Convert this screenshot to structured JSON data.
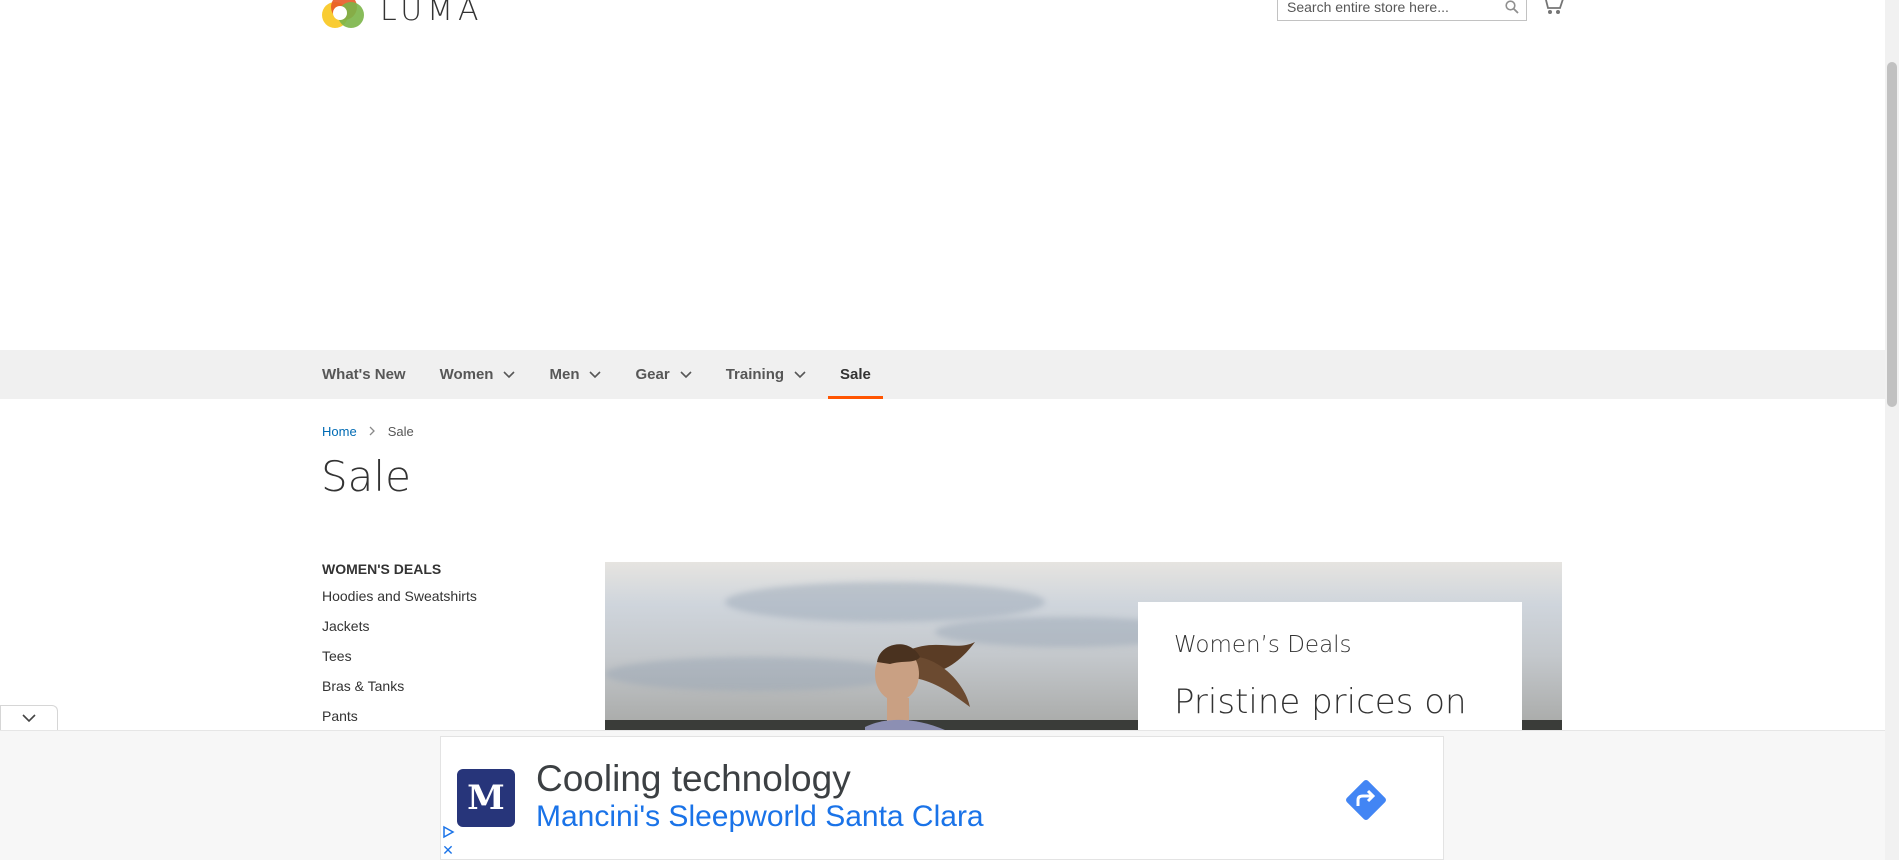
{
  "header": {
    "logo_text": "LUMA",
    "search_placeholder": "Search entire store here..."
  },
  "nav": {
    "items": [
      {
        "label": "What's New",
        "has_dropdown": false,
        "active": false
      },
      {
        "label": "Women",
        "has_dropdown": true,
        "active": false
      },
      {
        "label": "Men",
        "has_dropdown": true,
        "active": false
      },
      {
        "label": "Gear",
        "has_dropdown": true,
        "active": false
      },
      {
        "label": "Training",
        "has_dropdown": true,
        "active": false
      },
      {
        "label": "Sale",
        "has_dropdown": false,
        "active": true
      }
    ],
    "accent_color": "#ff5501"
  },
  "breadcrumb": {
    "home": "Home",
    "current": "Sale"
  },
  "page_title": "Sale",
  "sidebar": {
    "heading": "WOMEN'S DEALS",
    "links": [
      "Hoodies and Sweatshirts",
      "Jackets",
      "Tees",
      "Bras & Tanks",
      "Pants"
    ]
  },
  "banner": {
    "title": "Women’s Deals",
    "subtitle": "Pristine prices on"
  },
  "ad": {
    "logo_letter": "M",
    "headline": "Cooling technology",
    "advertiser": "Mancini's Sleepworld Santa Clara",
    "link_color": "#1a73e8",
    "brand_color": "#27357a"
  },
  "icons": {
    "search": "search-icon",
    "cart": "cart-icon",
    "chevron": "chevron-down-icon",
    "directions": "directions-icon",
    "adchoices": "adchoices-icon",
    "close": "close-icon"
  }
}
